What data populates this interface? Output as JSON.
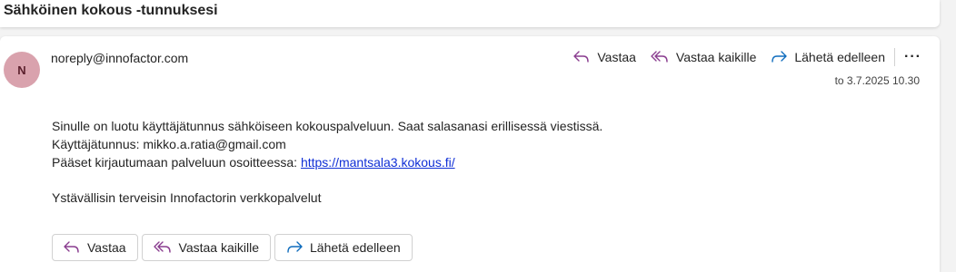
{
  "subject": "Sähköinen kokous -tunnuksesi",
  "sender": {
    "initial": "N",
    "address": "noreply@innofactor.com"
  },
  "header_actions": {
    "reply": "Vastaa",
    "reply_all": "Vastaa kaikille",
    "forward": "Lähetä edelleen",
    "more": "···"
  },
  "date": "to 3.7.2025 10.30",
  "body": {
    "line1": "Sinulle on luotu käyttäjätunnus sähköiseen kokouspalveluun. Saat salasanasi erillisessä viestissä.",
    "line2": "Käyttäjätunnus: mikko.a.ratia@gmail.com",
    "line3_prefix": "Pääset kirjautumaan palveluun osoitteessa: ",
    "link": "https://mantsala3.kokous.fi/",
    "signature": "Ystävällisin terveisin Innofactorin verkkopalvelut"
  },
  "bottom_actions": {
    "reply": "Vastaa",
    "reply_all": "Vastaa kaikille",
    "forward": "Lähetä edelleen"
  },
  "colors": {
    "reply_icon": "#8a3d8f",
    "forward_icon": "#0f6cbd",
    "avatar_bg": "#d9a2ad",
    "link": "#0f2fd6"
  }
}
